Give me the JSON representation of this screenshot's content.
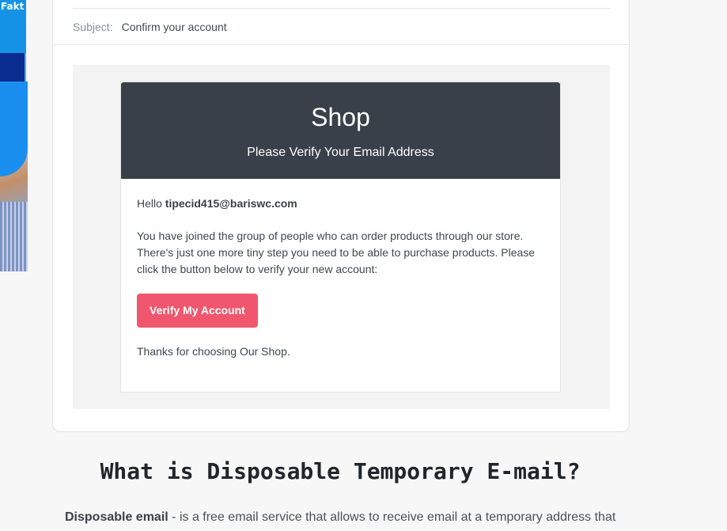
{
  "ad": {
    "text": "Fakt"
  },
  "email": {
    "subject_label": "Subject:",
    "subject_value": "Confirm your account",
    "shop_name": "Shop",
    "header_subtitle": "Please Verify Your Email Address",
    "greeting_prefix": "Hello ",
    "recipient": "tipecid415@bariswc.com",
    "message": "You have joined the group of people who can order products through our store. There's just one more tiny step you need to be able to purchase products. Please click the button below to verify your new account:",
    "verify_button": "Verify My Account",
    "thanks": "Thanks for choosing Our Shop."
  },
  "info": {
    "heading": "What is Disposable Temporary E-mail?",
    "lead_bold": "Disposable email",
    "lead_text": " - is a free email service that allows to receive email at a temporary address that"
  },
  "colors": {
    "header_bg": "#394049",
    "button_bg": "#f0566d",
    "page_bg": "#f7f7f7"
  }
}
